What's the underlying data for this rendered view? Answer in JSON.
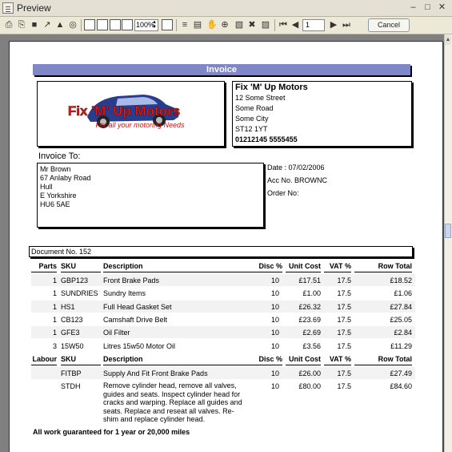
{
  "window": {
    "title": "Preview"
  },
  "toolbar": {
    "zoom": "100%",
    "page": "1",
    "cancel_label": "Cancel"
  },
  "invoice": {
    "title": "Invoice",
    "logo_text": "Fix 'M' Up Motors",
    "logo_tagline": "For all your motoring Needs",
    "company": {
      "name": "Fix 'M' Up Motors",
      "lines": [
        "12 Some Street",
        "Some Road",
        "Some City",
        "ST12 1YT"
      ],
      "phone": "01212145 5555455"
    },
    "invoice_to_label": "Invoice To:",
    "address": [
      "Mr Brown",
      "67 Anlaby Road",
      "Hull",
      "E Yorkshire",
      "HU6 5AE"
    ],
    "date": "Date : 07/02/2006",
    "account": "Acc No. BROWNC",
    "order": "Order No:",
    "document_no": "Document No. 152",
    "parts_headers": {
      "qty": "Parts",
      "sku": "SKU",
      "desc": "Description",
      "disc": "Disc %",
      "unit": "Unit Cost",
      "vat": "VAT %",
      "total": "Row Total"
    },
    "parts": [
      {
        "qty": "1",
        "sku": "GBP123",
        "desc": "Front Brake Pads",
        "disc": "10",
        "unit": "£17.51",
        "vat": "17.5",
        "total": "£18.52"
      },
      {
        "qty": "1",
        "sku": "SUNDRIES",
        "desc": "Sundry Items",
        "disc": "10",
        "unit": "£1.00",
        "vat": "17.5",
        "total": "£1.06"
      },
      {
        "qty": "1",
        "sku": "HS1",
        "desc": "Full Head Gasket Set",
        "disc": "10",
        "unit": "£26.32",
        "vat": "17.5",
        "total": "£27.84"
      },
      {
        "qty": "1",
        "sku": "CB123",
        "desc": "Camshaft Drive Belt",
        "disc": "10",
        "unit": "£23.69",
        "vat": "17.5",
        "total": "£25.05"
      },
      {
        "qty": "1",
        "sku": "GFE3",
        "desc": "Oil Filter",
        "disc": "10",
        "unit": "£2.69",
        "vat": "17.5",
        "total": "£2.84"
      },
      {
        "qty": "3",
        "sku": "15W50",
        "desc": "Litres 15w50 Motor Oil",
        "disc": "10",
        "unit": "£3.56",
        "vat": "17.5",
        "total": "£11.29"
      }
    ],
    "labour_headers": {
      "qty": "Labour",
      "sku": "SKU",
      "desc": "Description",
      "disc": "Disc %",
      "unit": "Unit Cost",
      "vat": "VAT %",
      "total": "Row Total"
    },
    "labour": [
      {
        "sku": "FITBP",
        "desc": "Supply And Fit Front Brake Pads",
        "disc": "10",
        "unit": "£26.00",
        "vat": "17.5",
        "total": "£27.49"
      },
      {
        "sku": "STDH",
        "desc": "Remove cylinder head, remove all valves, guides and seats.  Inspect cylinder head for cracks and warping.  Replace all guides and seats.  Replace and reseat all valves.  Re-shim and replace cylinder head.",
        "disc": "10",
        "unit": "£80.00",
        "vat": "17.5",
        "total": "£84.60"
      }
    ],
    "footer_note": "All work guaranteed for 1 year or 20,000 miles"
  }
}
